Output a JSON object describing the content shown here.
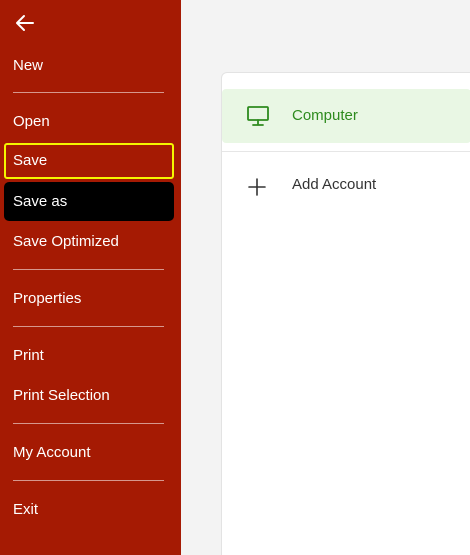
{
  "sidebar": {
    "back_icon": "arrow-left-icon",
    "background_color": "#a51a03",
    "items": {
      "new": "New",
      "open": "Open",
      "save": "Save",
      "save_as": "Save as",
      "save_optimized": "Save Optimized",
      "properties": "Properties",
      "print": "Print",
      "print_selection": "Print Selection",
      "my_account": "My Account",
      "exit": "Exit"
    },
    "focused_item": "Save",
    "hovered_item": "Save as"
  },
  "locations": {
    "computer": {
      "label": "Computer",
      "icon": "monitor-icon",
      "selected": true,
      "accent_color": "#2e8b1e"
    },
    "add_account": {
      "label": "Add Account",
      "icon": "plus-icon",
      "selected": false
    }
  }
}
